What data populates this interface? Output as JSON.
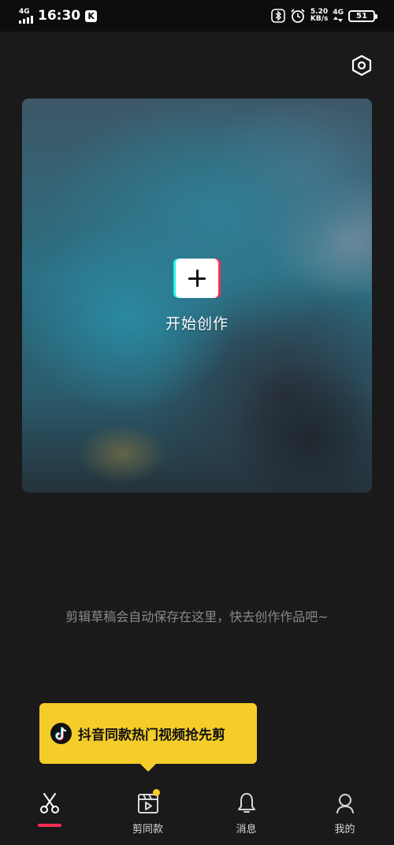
{
  "status_bar": {
    "network_left": "4G",
    "time": "16:30",
    "app_badge": "K",
    "speed_value": "5.20",
    "speed_unit": "KB/s",
    "network_right": "4G",
    "battery": "51"
  },
  "hero": {
    "create_label": "开始创作"
  },
  "hint": {
    "text": "剪辑草稿会自动保存在这里，快去创作作品吧~"
  },
  "tooltip": {
    "text": "抖音同款热门视频抢先剪"
  },
  "tabs": [
    {
      "label": "",
      "icon": "scissors-icon",
      "active": true
    },
    {
      "label": "剪同款",
      "icon": "clapperboard-icon",
      "active": false
    },
    {
      "label": "消息",
      "icon": "bell-icon",
      "active": false
    },
    {
      "label": "我的",
      "icon": "profile-icon",
      "active": false
    }
  ],
  "colors": {
    "accent_red": "#fe2c55",
    "accent_cyan": "#25f4ee",
    "tooltip_yellow": "#f5cd2a",
    "background": "#1a1a1a"
  }
}
